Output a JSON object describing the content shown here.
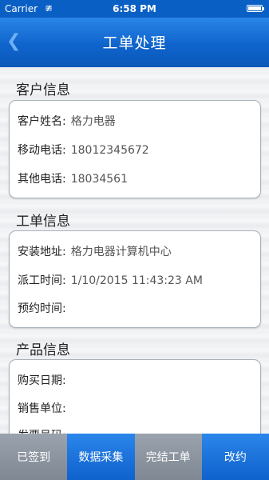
{
  "status_bar": {
    "carrier": "Carrier",
    "time": "6:58 PM",
    "wifi_icon": "wifi-icon",
    "battery_icon": "battery-icon"
  },
  "nav": {
    "title": "工单处理",
    "back_icon": "chevron-left-icon"
  },
  "customer": {
    "heading": "客户信息",
    "rows": [
      {
        "label": "客户姓名:",
        "value": "格力电器"
      },
      {
        "label": "移动电话:",
        "value": "18012345672"
      },
      {
        "label": "其他电话:",
        "value": "18034561"
      }
    ]
  },
  "order": {
    "heading": "工单信息",
    "rows": [
      {
        "label": "安装地址:",
        "value": "格力电器计算机中心"
      },
      {
        "label": "派工时间:",
        "value": "1/10/2015 11:43:23 AM"
      },
      {
        "label": "预约时间:",
        "value": ""
      }
    ]
  },
  "product": {
    "heading": "产品信息",
    "rows": [
      {
        "label": "购买日期:",
        "value": ""
      },
      {
        "label": "销售单位:",
        "value": ""
      },
      {
        "label": "发票号码:",
        "value": ""
      }
    ]
  },
  "tabs": [
    {
      "label": "已签到",
      "color": "#8a939d"
    },
    {
      "label": "数据采集",
      "color": "#1670d8"
    },
    {
      "label": "完结工单",
      "color": "#8a939d"
    },
    {
      "label": "改约",
      "color": "#1670d8"
    }
  ]
}
